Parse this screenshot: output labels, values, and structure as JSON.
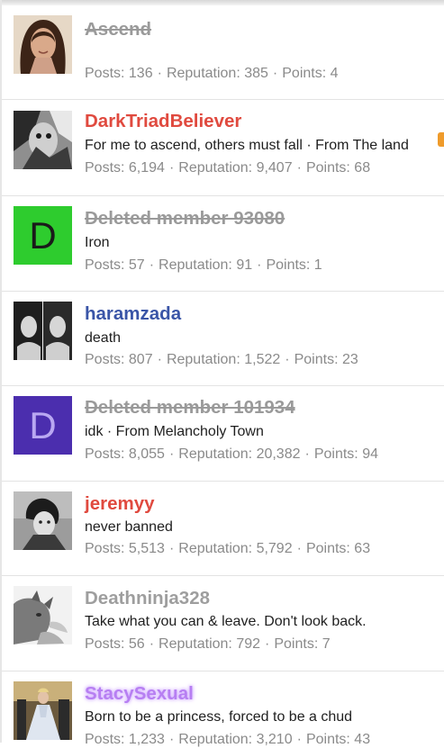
{
  "separator": "·",
  "members": [
    {
      "name": "Ascend",
      "name_style": "struck",
      "signature": "",
      "stats": {
        "posts_label": "Posts: 136",
        "rep_label": "Reputation: 385",
        "points_label": "Points: 4"
      },
      "avatar": "photo-girl-smiling"
    },
    {
      "name": "DarkTriadBeliever",
      "name_style": "red",
      "signature": "For me to ascend, others must fall · From The land",
      "stats": {
        "posts_label": "Posts: 6,194",
        "rep_label": "Reputation: 9,407",
        "points_label": "Points: 68"
      },
      "avatar": "photo-bw-art"
    },
    {
      "name": "Deleted member 93080",
      "name_style": "struck",
      "signature": "Iron",
      "stats": {
        "posts_label": "Posts: 57",
        "rep_label": "Reputation: 91",
        "points_label": "Points: 1"
      },
      "avatar": "letter",
      "avatar_letter": "D",
      "avatar_color": "#2ecc2e"
    },
    {
      "name": "haramzada",
      "name_style": "blue",
      "signature": "death",
      "stats": {
        "posts_label": "Posts: 807",
        "rep_label": "Reputation: 1,522",
        "points_label": "Points: 23"
      },
      "avatar": "photo-bw-twins"
    },
    {
      "name": "Deleted member 101934",
      "name_style": "struck",
      "signature": "idk · From Melancholy Town",
      "stats": {
        "posts_label": "Posts: 8,055",
        "rep_label": "Reputation: 20,382",
        "points_label": "Points: 94"
      },
      "avatar": "letter",
      "avatar_letter": "D",
      "avatar_color": "#4b2eae",
      "avatar_letter_color": "#b9a8f2"
    },
    {
      "name": "jeremyy",
      "name_style": "red",
      "signature": "never banned",
      "stats": {
        "posts_label": "Posts: 5,513",
        "rep_label": "Reputation: 5,792",
        "points_label": "Points: 63"
      },
      "avatar": "photo-bw-man"
    },
    {
      "name": "Deathninja328",
      "name_style": "gray",
      "signature": "Take what you can & leave. Don't look back.",
      "stats": {
        "posts_label": "Posts: 56",
        "rep_label": "Reputation: 792",
        "points_label": "Points: 7"
      },
      "avatar": "photo-cat"
    },
    {
      "name": "StacySexual",
      "name_style": "glow",
      "signature": "Born to be a princess, forced to be a chud",
      "stats": {
        "posts_label": "Posts: 1,233",
        "rep_label": "Reputation: 3,210",
        "points_label": "Points: 43"
      },
      "avatar": "photo-gown"
    }
  ]
}
